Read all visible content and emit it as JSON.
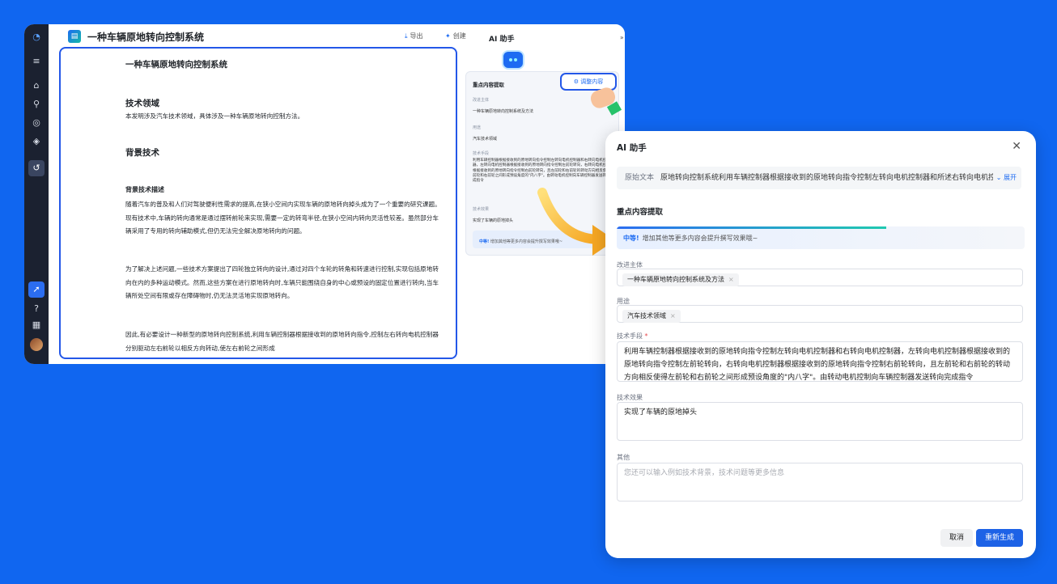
{
  "app": {
    "nav_icons": [
      "logo-icon",
      "menu-expand-icon",
      "home-icon",
      "search-icon",
      "broadcast-icon",
      "layers-icon",
      "history-icon",
      "rocket-icon",
      "help-icon",
      "grid-apps-icon"
    ]
  },
  "doc_header": {
    "title": "一种车辆原地转向控制系统",
    "export_label": "导出",
    "create_label": "创建"
  },
  "document": {
    "title": "一种车辆原地转向控制系统",
    "h_field": "技术领域",
    "p_field": "本发明涉及汽车技术领域，具体涉及一种车辆原地转向控制方法。",
    "h_background": "背景技术",
    "h_bg_desc": "背景技术描述",
    "p1": "随着汽车的普及和人们对驾驶便利性需求的提高,在狭小空间内实现车辆的原地转向掉头成为了一个重要的研究课题。现有技术中,车辆的转向通常是通过摆转前轮来实现,需要一定的转弯半径,在狭小空间内转向灵活性较差。虽然部分车辆采用了专用的转向辅助模式,但仍无法完全解决原地转向的问题。",
    "p2": "为了解决上述问题,一些技术方案提出了四轮独立转向的设计,通过对四个车轮的转角和转速进行控制,实现包括原地转向在内的多种运动模式。然而,这些方案在进行原地转向时,车辆只能围绕自身的中心或预设的固定位置进行转向,当车辆所处空间有限或存在障碍物时,仍无法灵活地实现原地转向。",
    "p3": "因此,有必要设计一种新型的原地转向控制系统,利用车辆控制器根据接收到的原地转向指令,控制左右转向电机控制器分别驱动左右前轮以相反方向转动,使左右前轮之间形成"
  },
  "ai_side": {
    "title": "AI 助手",
    "fold_label": "折叠",
    "card_title": "重点内容提取",
    "adjust_label": "调整内容",
    "l_subject": "改进主体",
    "v_subject": "一种车辆原地转向控制系统及方法",
    "l_use": "用途",
    "v_use": "汽车技术领域",
    "l_means": "技术手段",
    "v_means": "利用车辆控制器根据接收到的原地转向指令控制左转向电机控制器和右转向电机控制器，左转向电机控制器根据接收到的原地转向指令控制左前轮转向，右转向电机控制器根据接收到的原地转向指令控制右前轮转向，且左前轮和右前轮的转动方向相反使得左前轮和右前轮之间形成预设角度的\"内八字\"。由转动电机控制向车辆控制器发送转向完成指令",
    "l_effect": "技术效果",
    "v_effect": "实现了车辆的原地掉头",
    "bar_level": "中等!",
    "bar_text": "增加其他等更多内容会提升撰写效果哦~"
  },
  "modal": {
    "title": "AI 助手",
    "orig_label": "原始文本",
    "orig_text": "原地转向控制系统利用车辆控制器根据接收到的原地转向指令控制左转向电机控制器和所述右转向电机控制器",
    "expand_label": "展开",
    "section_title": "重点内容提取",
    "progress": 0.66,
    "level": "中等!",
    "level_text": "增加其他等更多内容会提升撰写效果哦~",
    "l_subject": "改进主体",
    "tag_subject": "一种车辆原地转向控制系统及方法",
    "l_use": "用途",
    "tag_use": "汽车技术领域",
    "l_means": "技术手段",
    "means_req": "*",
    "means_text": "利用车辆控制器根据接收到的原地转向指令控制左转向电机控制器和右转向电机控制器，左转向电机控制器根据接收到的原地转向指令控制左前轮转向，右转向电机控制器根据接收到的原地转向指令控制右前轮转向，且左前轮和右前轮的转动方向相反使得左前轮和右前轮之间形成预设角度的\"内八字\"。由转动电机控制向车辆控制器发送转向完成指令",
    "l_effect": "技术效果",
    "effect_text": "实现了车辆的原地掉头",
    "l_other": "其他",
    "other_placeholder": "您还可以输入例如技术背景，技术问题等更多信息",
    "cancel_label": "取消",
    "regen_label": "重新生成"
  }
}
